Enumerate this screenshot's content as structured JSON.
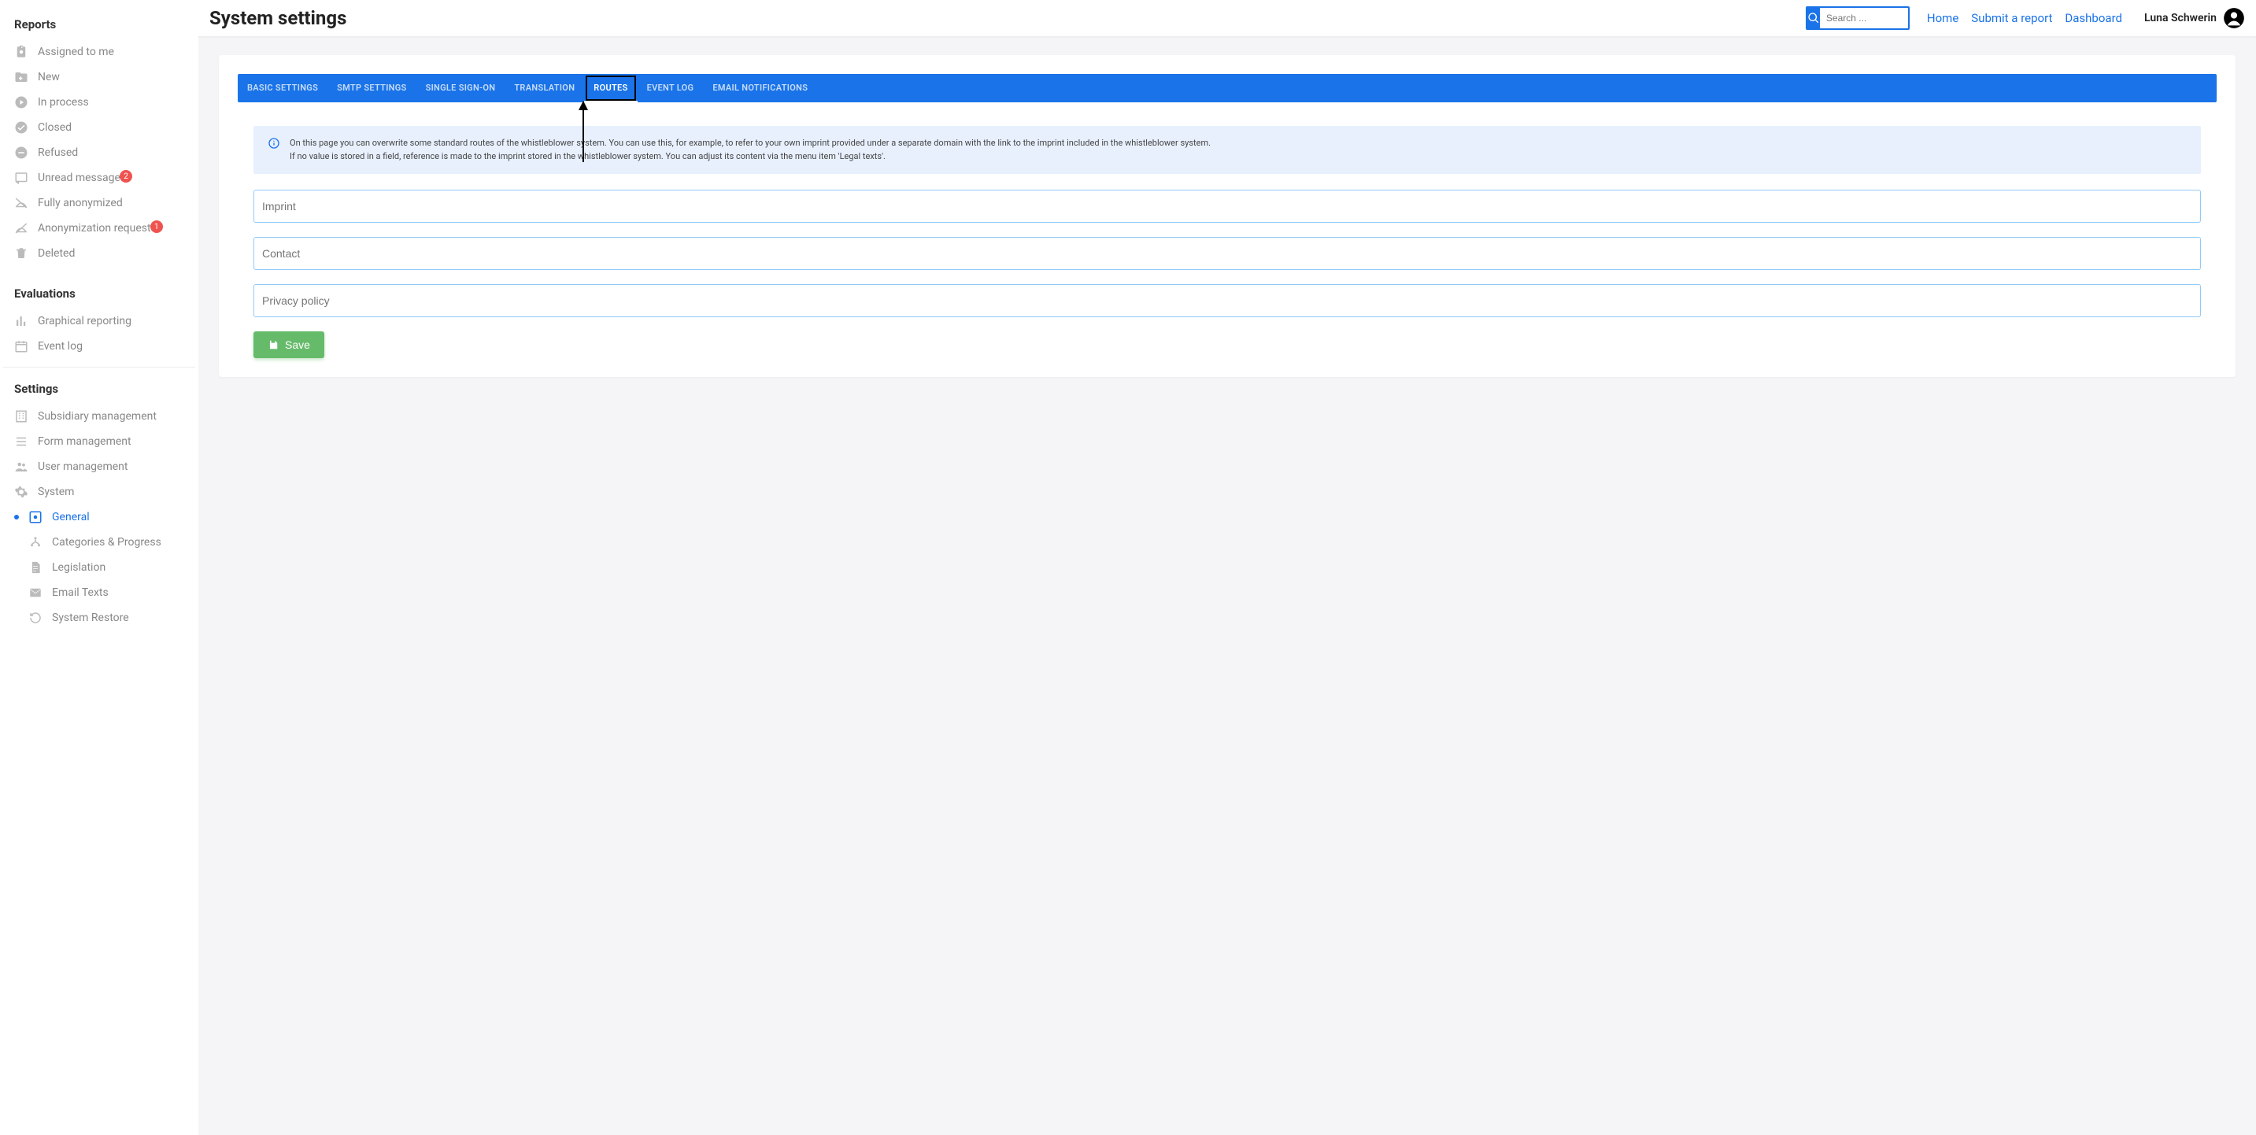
{
  "sidebar": {
    "sections": {
      "reports": {
        "heading": "Reports",
        "items": [
          {
            "label": "Assigned to me"
          },
          {
            "label": "New"
          },
          {
            "label": "In process"
          },
          {
            "label": "Closed"
          },
          {
            "label": "Refused"
          },
          {
            "label": "Unread messages",
            "badge": "2"
          },
          {
            "label": "Fully anonymized"
          },
          {
            "label": "Anonymization requests",
            "badge": "1"
          },
          {
            "label": "Deleted"
          }
        ]
      },
      "evaluations": {
        "heading": "Evaluations",
        "items": [
          {
            "label": "Graphical reporting"
          },
          {
            "label": "Event log"
          }
        ]
      },
      "settings": {
        "heading": "Settings",
        "items": [
          {
            "label": "Subsidiary management"
          },
          {
            "label": "Form management"
          },
          {
            "label": "User management"
          },
          {
            "label": "System"
          },
          {
            "label": "General"
          },
          {
            "label": "Categories & Progress"
          },
          {
            "label": "Legislation"
          },
          {
            "label": "Email Texts"
          },
          {
            "label": "System Restore"
          }
        ]
      }
    }
  },
  "topbar": {
    "title": "System settings",
    "search_placeholder": "Search ...",
    "links": {
      "home": "Home",
      "submit": "Submit a report",
      "dashboard": "Dashboard"
    },
    "user": "Luna Schwerin"
  },
  "tabs": [
    {
      "label": "BASIC SETTINGS"
    },
    {
      "label": "SMTP SETTINGS"
    },
    {
      "label": "SINGLE SIGN-ON"
    },
    {
      "label": "TRANSLATION"
    },
    {
      "label": "ROUTES"
    },
    {
      "label": "EVENT LOG"
    },
    {
      "label": "EMAIL NOTIFICATIONS"
    }
  ],
  "info": {
    "line1": "On this page you can overwrite some standard routes of the whistleblower system. You can use this, for example, to refer to your own imprint provided under a separate domain with the link to the imprint included in the whistleblower system.",
    "line2": "If no value is stored in a field, reference is made to the imprint stored in the whistleblower system. You can adjust its content via the menu item 'Legal texts'."
  },
  "fields": {
    "imprint": {
      "placeholder": "Imprint",
      "value": ""
    },
    "contact": {
      "placeholder": "Contact",
      "value": ""
    },
    "privacy": {
      "placeholder": "Privacy policy",
      "value": ""
    }
  },
  "buttons": {
    "save": "Save"
  }
}
